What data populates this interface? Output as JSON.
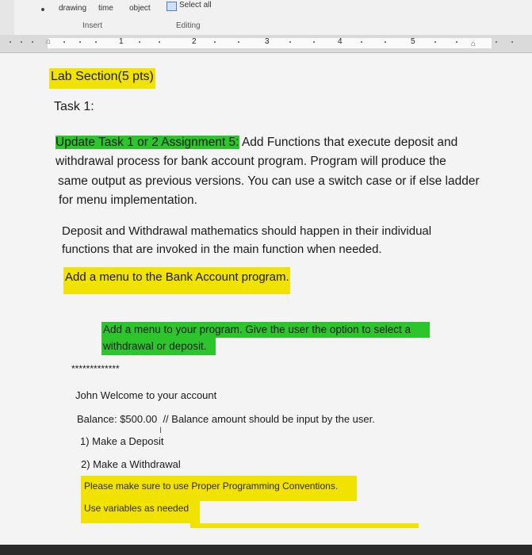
{
  "ribbon": {
    "commands": [
      "drawing",
      "time",
      "object"
    ],
    "select_all": "Select all",
    "groups": [
      "Insert",
      "Editing"
    ]
  },
  "ruler": {
    "numbers": [
      "1",
      "2",
      "3",
      "4",
      "5"
    ]
  },
  "document": {
    "heading": "Lab Section(5 pts)",
    "task_title": "Task 1:",
    "update_highlight": "Update Task 1 or 2 Assignment 5:",
    "para1_line1_rest": " Add Functions that execute deposit and",
    "para1_line2": "withdrawal process for bank account program. Program will produce the",
    "para1_line3": "same output as previous versions. You can use a switch case or if else ladder",
    "para1_line4": "for menu implementation.",
    "para2_line1": "Deposit and Withdrawal mathematics should happen in their individual",
    "para2_line2": "functions that are invoked in the main function when needed.",
    "menu_line": "Add a menu to the Bank Account program.",
    "green_line1": "Add a menu to your program. Give the user the option to select a",
    "green_line2": "withdrawal or deposit.",
    "stars": "*************",
    "welcome": "John Welcome to your account",
    "balance": "Balance: $500.00",
    "balance_comment": "// Balance amount should be input by the user.",
    "option1": "1) Make a Deposit",
    "option2": "2) Make a Withdrawal",
    "note1": "Please make sure to use Proper Programming Conventions.",
    "note2": "Use variables as needed"
  },
  "colors": {
    "highlight_yellow": "#f2e200",
    "highlight_green": "#2cc52c"
  }
}
